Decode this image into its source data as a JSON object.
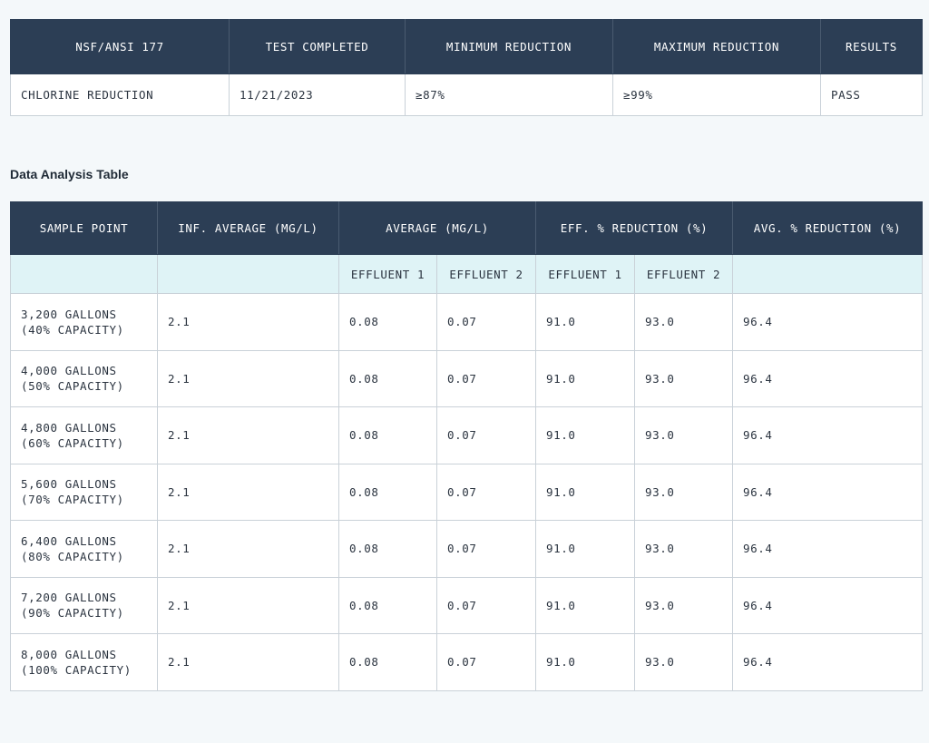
{
  "summary": {
    "headers": [
      "NSF/ANSI 177",
      "TEST COMPLETED",
      "MINIMUM REDUCTION",
      "MAXIMUM REDUCTION",
      "RESULTS"
    ],
    "row": [
      "CHLORINE REDUCTION",
      "11/21/2023",
      "≥87%",
      "≥99%",
      "PASS"
    ]
  },
  "analysis": {
    "title": "Data Analysis Table",
    "headers": [
      "SAMPLE POINT",
      "INF. AVERAGE (MG/L)",
      "AVERAGE (MG/L)",
      "EFF. % REDUCTION (%)",
      "AVG. % REDUCTION (%)"
    ],
    "subheaders": [
      "EFFLUENT 1",
      "EFFLUENT 2",
      "EFFLUENT 1",
      "EFFLUENT 2"
    ],
    "rows": [
      {
        "sample": "3,200 GALLONS\n(40% CAPACITY)",
        "inf": "2.1",
        "avg1": "0.08",
        "avg2": "0.07",
        "eff1": "91.0",
        "eff2": "93.0",
        "avg_red": "96.4"
      },
      {
        "sample": "4,000 GALLONS\n(50% CAPACITY)",
        "inf": "2.1",
        "avg1": "0.08",
        "avg2": "0.07",
        "eff1": "91.0",
        "eff2": "93.0",
        "avg_red": "96.4"
      },
      {
        "sample": "4,800 GALLONS\n(60% CAPACITY)",
        "inf": "2.1",
        "avg1": "0.08",
        "avg2": "0.07",
        "eff1": "91.0",
        "eff2": "93.0",
        "avg_red": "96.4"
      },
      {
        "sample": "5,600 GALLONS\n(70% CAPACITY)",
        "inf": "2.1",
        "avg1": "0.08",
        "avg2": "0.07",
        "eff1": "91.0",
        "eff2": "93.0",
        "avg_red": "96.4"
      },
      {
        "sample": "6,400 GALLONS\n(80% CAPACITY)",
        "inf": "2.1",
        "avg1": "0.08",
        "avg2": "0.07",
        "eff1": "91.0",
        "eff2": "93.0",
        "avg_red": "96.4"
      },
      {
        "sample": "7,200 GALLONS\n(90% CAPACITY)",
        "inf": "2.1",
        "avg1": "0.08",
        "avg2": "0.07",
        "eff1": "91.0",
        "eff2": "93.0",
        "avg_red": "96.4"
      },
      {
        "sample": "8,000 GALLONS\n(100% CAPACITY)",
        "inf": "2.1",
        "avg1": "0.08",
        "avg2": "0.07",
        "eff1": "91.0",
        "eff2": "93.0",
        "avg_red": "96.4"
      }
    ]
  },
  "colors": {
    "header_bg": "#2c3e55",
    "subheader_bg": "#dff3f6",
    "page_bg": "#f4f8fa"
  }
}
